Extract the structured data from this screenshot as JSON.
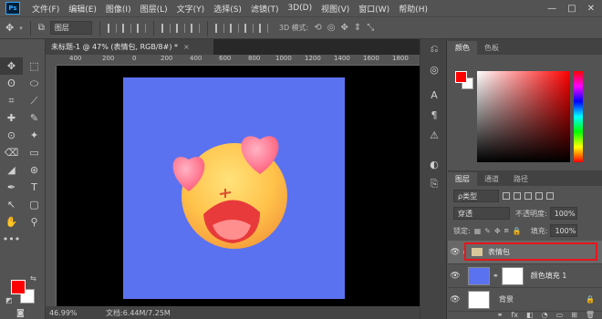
{
  "app": {
    "logo": "Ps"
  },
  "menu": [
    "文件(F)",
    "编辑(E)",
    "图像(I)",
    "图层(L)",
    "文字(Y)",
    "选择(S)",
    "滤镜(T)",
    "3D(D)",
    "视图(V)",
    "窗口(W)",
    "帮助(H)"
  ],
  "window_controls": [
    "—",
    "□",
    "✕"
  ],
  "options": {
    "auto_select_value": "图层",
    "mode_label": "3D 模式:"
  },
  "document": {
    "tab_title": "未标题-1 @ 47% (表情包, RGB/8#) *",
    "ruler_ticks": [
      "400",
      "200",
      "0",
      "200",
      "400",
      "600",
      "800",
      "1000",
      "1200",
      "1400",
      "1600",
      "1800"
    ],
    "zoom": "46.99%",
    "doc_info": "文档:6.44M/7.25M",
    "artboard_color": "#5b72f0"
  },
  "tools": [
    "✥",
    "⬚",
    "ʘ",
    "⬭",
    "⌗",
    "⟋",
    "✚",
    "✎",
    "⊙",
    "✦",
    "⌫",
    "▭",
    "◢",
    "⊛",
    "✒",
    "T",
    "↖",
    "▢",
    "✋",
    "⚲",
    "•••",
    ""
  ],
  "colors": {
    "foreground": "#ff0000",
    "background": "#ffffff",
    "accent_red": "#e8151b"
  },
  "color_panel": {
    "tabs": [
      "颜色",
      "色板"
    ]
  },
  "layers_panel": {
    "tabs": [
      "图层",
      "通道",
      "路径"
    ],
    "filter_kind": "ρ类型",
    "blend_mode": "穿透",
    "opacity_label": "不透明度:",
    "opacity_value": "100%",
    "lock_label": "锁定:",
    "fill_label": "填充:",
    "fill_value": "100%",
    "layers": [
      {
        "name": "表情包",
        "kind": "group",
        "selected": true
      },
      {
        "name": "颜色填充 1",
        "kind": "fill"
      },
      {
        "name": "背景",
        "kind": "background",
        "locked": true
      }
    ],
    "bottom_icons": [
      "⚭",
      "fx",
      "◧",
      "◔",
      "▭",
      "⊞",
      "🗑"
    ]
  }
}
